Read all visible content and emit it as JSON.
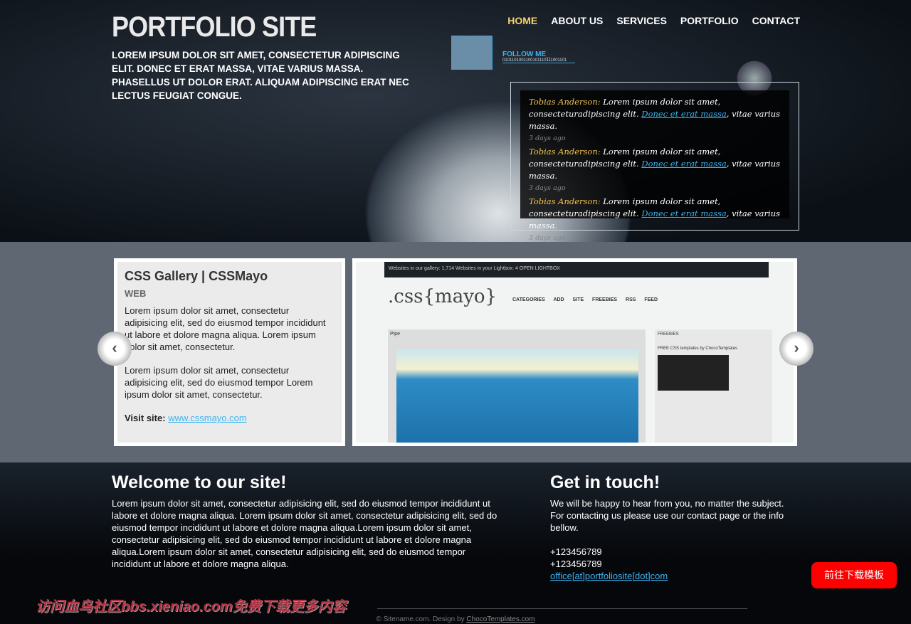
{
  "header": {
    "logo": "PORTFOLIO SITE",
    "intro": "Lorem ipsum dolor sit amet, consectetur adipiscing elit. Donec et erat massa, vitae varius massa. Phasellus ut dolor erat. Aliquam adipiscing erat nec lectus feugiat congue.",
    "nav": [
      {
        "label": "HOME",
        "active": true
      },
      {
        "label": "ABOUT US"
      },
      {
        "label": "SERVICES"
      },
      {
        "label": "PORTFOLIO"
      },
      {
        "label": "CONTACT"
      }
    ],
    "follow": {
      "label": "FOLLOW ME_",
      "binary": "0101101001100101110111001101"
    },
    "tweets": [
      {
        "author": "Tobias Anderson:",
        "text": " Lorem ipsum dolor sit amet, consecteturadipiscing elit. ",
        "link": "Donec et erat massa",
        "after": ", vitae varius massa.",
        "time": "3 days ago"
      },
      {
        "author": "Tobias Anderson:",
        "text": " Lorem ipsum dolor sit amet, consecteturadipiscing elit. ",
        "link": "Donec et erat massa",
        "after": ", vitae varius massa.",
        "time": "3 days ago"
      },
      {
        "author": "Tobias Anderson:",
        "text": " Lorem ipsum dolor sit amet, consecteturadipiscing elit. ",
        "link": "Donec et erat massa",
        "after": ", vitae varius massa.",
        "time": "3 days ago"
      }
    ]
  },
  "gallery": {
    "title": "CSS Gallery | CSSMayo",
    "category": "WEB",
    "p1": "Lorem ipsum dolor sit amet, consectetur adipisicing elit, sed do eiusmod tempor incididunt ut labore et dolore magna aliqua. Lorem ipsum dolor sit amet, consectetur.",
    "p2": "Lorem ipsum dolor sit amet, consectetur adipisicing elit, sed do eiusmod tempor Lorem ipsum dolor sit amet, consectetur.",
    "visit_label": "Visit site:",
    "visit_link": "www.cssmayo.com",
    "screenshot": {
      "bar": "Websites in our gallery: 1,714   Websites in your Lightbox: 4   OPEN LIGHTBOX",
      "logo": ".css{mayo}",
      "menu": "CATEGORIES ADD SITE FREEBIES RSS FEED",
      "pipe": "Pipe",
      "freebies": "FREEBIES",
      "free_text": "FREE CSS templates by ChocoTemplates"
    },
    "prev": "‹",
    "next": "›"
  },
  "welcome": {
    "title": "Welcome to our site!",
    "text": "Lorem ipsum dolor sit amet, consectetur adipisicing elit, sed do eiusmod tempor incididunt ut labore et dolore magna aliqua. Lorem ipsum dolor sit amet, consectetur adipisicing elit, sed do eiusmod tempor incididunt ut labore et dolore magna aliqua.Lorem ipsum dolor sit amet, consectetur adipisicing elit, sed do eiusmod tempor incididunt ut labore et dolore magna aliqua.Lorem ipsum dolor sit amet, consectetur adipisicing elit, sed do eiusmod tempor incididunt ut labore et dolore magna aliqua."
  },
  "contact": {
    "title": "Get in touch!",
    "text": "We will be happy to hear from you, no matter the subject. For contacting us please use our contact page or the info bellow.",
    "phone1": "+123456789",
    "phone2": "+123456789",
    "email": "office[at]portfoliosite[dot]com"
  },
  "download_button": "前往下载模板",
  "watermark": "访问血鸟社区bbs.xieniao.com免费下载更多内容",
  "footer": {
    "copy": "© Sitename.com. Design by ",
    "link": "ChocoTemplates.com"
  }
}
